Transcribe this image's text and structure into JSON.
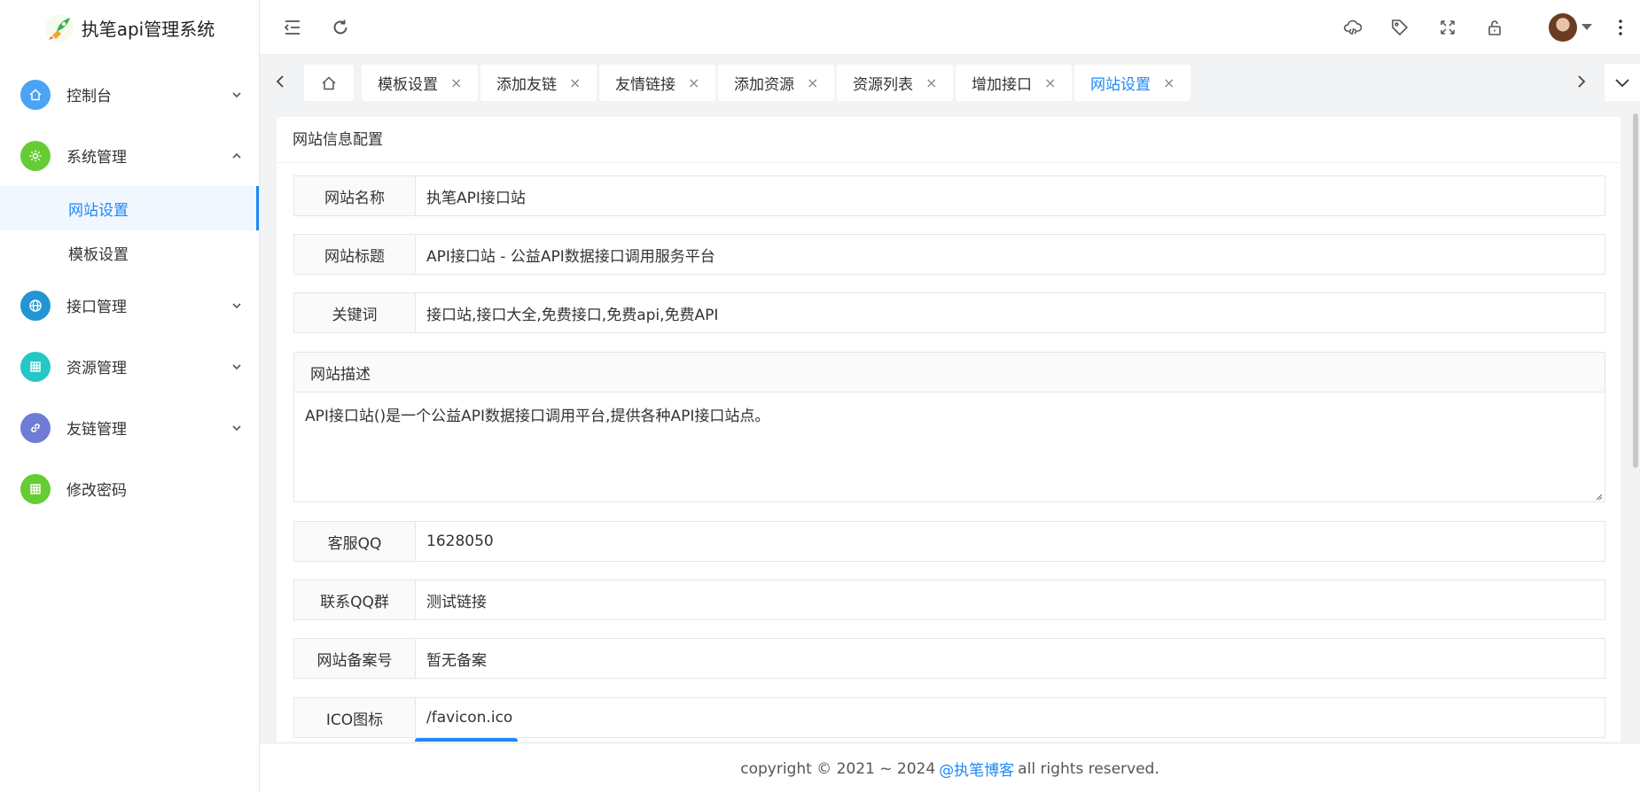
{
  "app": {
    "title": "执笔api管理系统"
  },
  "sidebar": {
    "items": [
      {
        "label": "控制台",
        "icon": "home-icon",
        "color": "#4aa3f5",
        "expanded": false
      },
      {
        "label": "系统管理",
        "icon": "gear-icon",
        "color": "#66cc33",
        "expanded": true,
        "children": [
          {
            "label": "网站设置",
            "active": true
          },
          {
            "label": "模板设置",
            "active": false
          }
        ]
      },
      {
        "label": "接口管理",
        "icon": "globe-icon",
        "color": "#2196d3",
        "expanded": false
      },
      {
        "label": "资源管理",
        "icon": "grid-icon",
        "color": "#26c6c6",
        "expanded": false
      },
      {
        "label": "友链管理",
        "icon": "link-icon",
        "color": "#6f7cd4",
        "expanded": false
      },
      {
        "label": "修改密码",
        "icon": "grid-icon",
        "color": "#66cc33"
      }
    ]
  },
  "tabs": [
    {
      "label": "模板设置"
    },
    {
      "label": "添加友链"
    },
    {
      "label": "友情链接"
    },
    {
      "label": "添加资源"
    },
    {
      "label": "资源列表"
    },
    {
      "label": "增加接口"
    },
    {
      "label": "网站设置",
      "active": true
    }
  ],
  "tab_close_glyph": "×",
  "card": {
    "title": "网站信息配置",
    "fields": {
      "site_name": {
        "label": "网站名称",
        "value": "执笔API接口站"
      },
      "site_title": {
        "label": "网站标题",
        "value": "API接口站 - 公益API数据接口调用服务平台"
      },
      "keywords": {
        "label": "关键词",
        "value": "接口站,接口大全,免费接口,免费api,免费API"
      },
      "description": {
        "label": "网站描述",
        "value": "API接口站()是一个公益API数据接口调用平台,提供各种API接口站点。"
      },
      "service_qq": {
        "label": "客服QQ",
        "value": "1628050"
      },
      "qq_group": {
        "label": "联系QQ群",
        "value": "测试链接"
      },
      "icp": {
        "label": "网站备案号",
        "value": "暂无备案"
      },
      "ico": {
        "label": "ICO图标",
        "value": "/favicon.ico"
      }
    }
  },
  "footer": {
    "prefix": "copyright © 2021 ~ 2024",
    "link": "@执笔博客",
    "suffix": "all rights reserved."
  },
  "colors": {
    "accent": "#1e88f5"
  }
}
